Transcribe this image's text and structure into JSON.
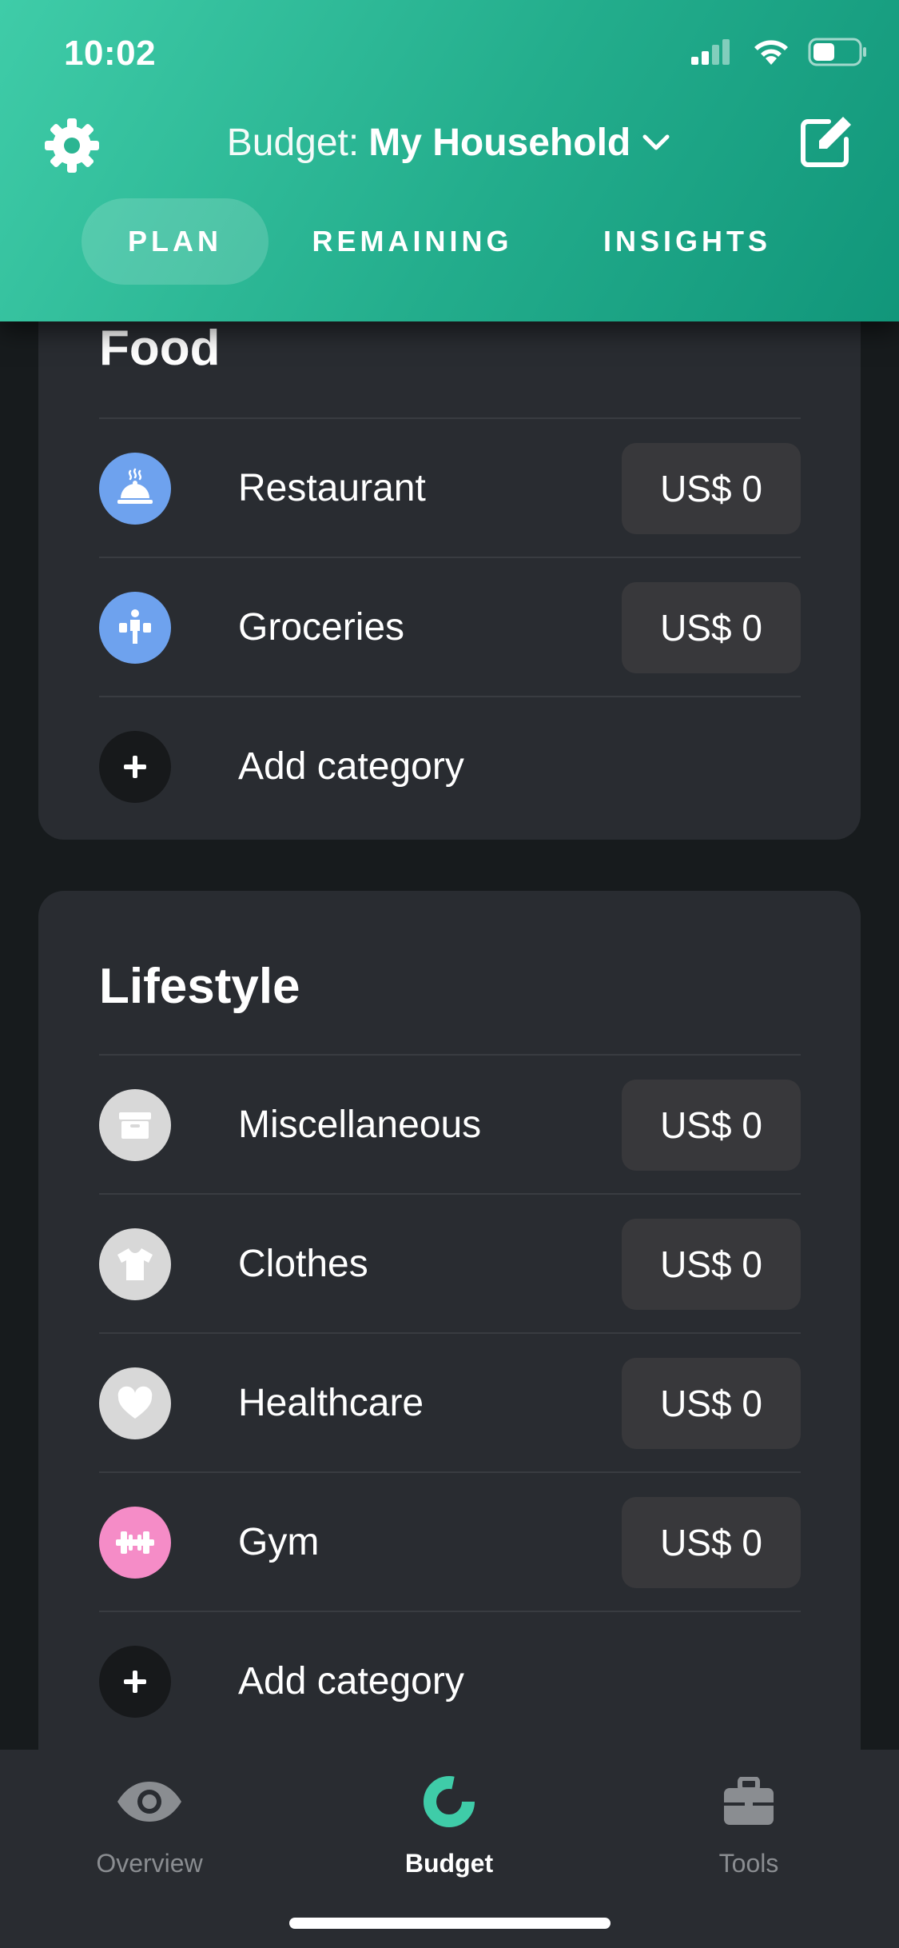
{
  "status_bar": {
    "time": "10:02"
  },
  "header": {
    "budget_label": "Budget:",
    "budget_name": "My Household",
    "tabs": [
      {
        "label": "PLAN",
        "active": true
      },
      {
        "label": "REMAINING",
        "active": false
      },
      {
        "label": "INSIGHTS",
        "active": false
      }
    ]
  },
  "groups": [
    {
      "title": "Food",
      "items": [
        {
          "name": "Restaurant",
          "amount": "US$ 0",
          "icon": "cloche-icon",
          "color": "#6ea2ee"
        },
        {
          "name": "Groceries",
          "amount": "US$ 0",
          "icon": "shopper-icon",
          "color": "#6ea2ee"
        }
      ],
      "add_label": "Add category"
    },
    {
      "title": "Lifestyle",
      "items": [
        {
          "name": "Miscellaneous",
          "amount": "US$ 0",
          "icon": "box-icon",
          "color": "#d8d8d8"
        },
        {
          "name": "Clothes",
          "amount": "US$ 0",
          "icon": "tshirt-icon",
          "color": "#d8d8d8"
        },
        {
          "name": "Healthcare",
          "amount": "US$ 0",
          "icon": "heart-icon",
          "color": "#d8d8d8"
        },
        {
          "name": "Gym",
          "amount": "US$ 0",
          "icon": "dumbbell-icon",
          "color": "#f58cc7"
        }
      ],
      "add_label": "Add category"
    }
  ],
  "bottom_nav": [
    {
      "label": "Overview",
      "icon": "eye-icon",
      "active": false
    },
    {
      "label": "Budget",
      "icon": "donut-chart-icon",
      "active": true
    },
    {
      "label": "Tools",
      "icon": "toolbox-icon",
      "active": false
    }
  ],
  "colors": {
    "accent": "#2bb592",
    "background": "#171b1d",
    "card": "#292c31"
  }
}
